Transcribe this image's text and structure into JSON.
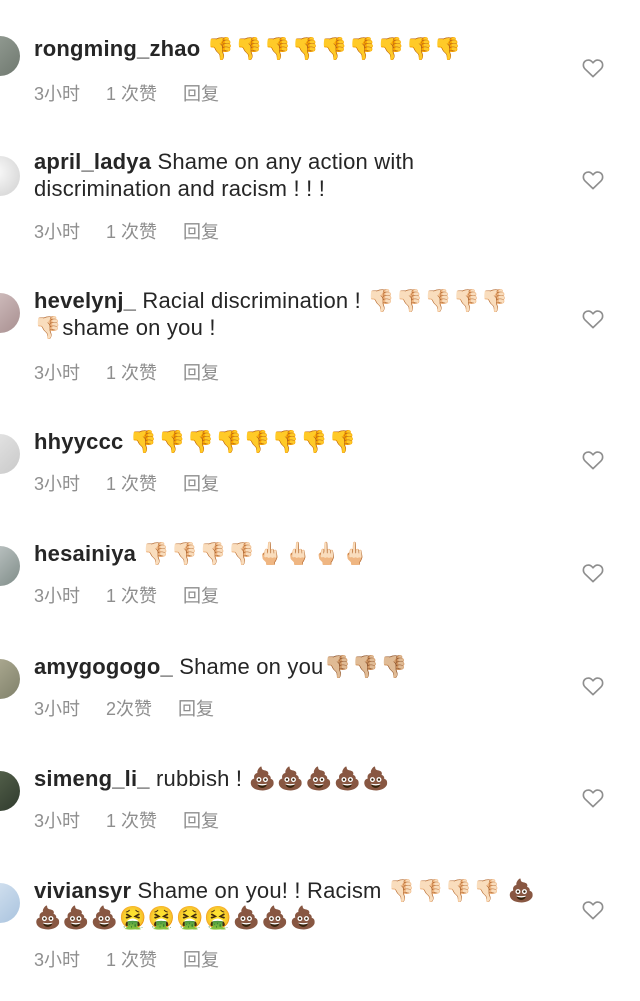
{
  "comments": [
    {
      "username": "rongming_zhao",
      "text": "",
      "emoji": "👎👎👎👎👎👎👎👎👎",
      "time": "3小时",
      "likes": "1 次赞",
      "reply": "回复"
    },
    {
      "username": "april_ladya",
      "text": "Shame on any action with discrimination and racism ! ! !",
      "emoji": "",
      "time": "3小时",
      "likes": "1 次赞",
      "reply": "回复"
    },
    {
      "username": "hevelynj_",
      "text": "Racial discrimination !",
      "emoji": "👎🏻👎🏻👎🏻👎🏻👎🏻👎🏻",
      "text2": "shame on you !",
      "time": "3小时",
      "likes": "1 次赞",
      "reply": "回复"
    },
    {
      "username": "hhyyccc",
      "text": "",
      "emoji": "👎👎👎👎👎👎👎👎",
      "time": "3小时",
      "likes": "1 次赞",
      "reply": "回复"
    },
    {
      "username": "hesainiya",
      "text": "",
      "emoji": "👎🏻👎🏻👎🏻👎🏻🖕🏻🖕🏻🖕🏻🖕🏻",
      "time": "3小时",
      "likes": "1 次赞",
      "reply": "回复"
    },
    {
      "username": "amygogogo_",
      "text": "Shame on you",
      "emoji": "👎🏼👎🏼👎🏼",
      "time": "3小时",
      "likes": "2次赞",
      "reply": "回复"
    },
    {
      "username": "simeng_li_",
      "text": "rubbish !",
      "emoji": "💩💩💩💩💩",
      "time": "3小时",
      "likes": "1 次赞",
      "reply": "回复"
    },
    {
      "username": "viviansyr",
      "text": "Shame on you! ! Racism",
      "emoji": "👎🏻👎🏻👎🏻👎🏻",
      "emoji2": "💩💩💩💩🤮🤮🤮🤮💩💩💩",
      "time": "3小时",
      "likes": "1 次赞",
      "reply": "回复"
    }
  ],
  "icons": {
    "like": "heart-outline-icon"
  },
  "colors": {
    "text": "#262626",
    "meta": "#8e8e8e",
    "background": "#ffffff"
  }
}
